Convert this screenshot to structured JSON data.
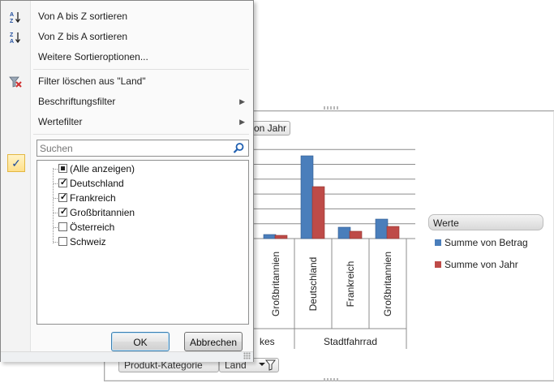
{
  "sort_menu": {
    "sort_az": "Von A bis Z sortieren",
    "sort_za": "Von Z bis A sortieren",
    "more_sort": "Weitere Sortieroptionen...",
    "clear_filter": "Filter löschen aus \"Land\"",
    "label_filter": "Beschriftungsfilter",
    "value_filter": "Wertefilter"
  },
  "search": {
    "placeholder": "Suchen"
  },
  "filter_list": [
    {
      "label": "(Alle anzeigen)",
      "state": "indeterminate"
    },
    {
      "label": "Deutschland",
      "state": "checked"
    },
    {
      "label": "Frankreich",
      "state": "checked"
    },
    {
      "label": "Großbritannien",
      "state": "checked"
    },
    {
      "label": "Österreich",
      "state": "unchecked"
    },
    {
      "label": "Schweiz",
      "state": "unchecked"
    }
  ],
  "buttons": {
    "ok": "OK",
    "cancel": "Abbrechen"
  },
  "chart_fields": {
    "column_field": "von Jahr",
    "row_field_1": "Produkt-Kategorie",
    "row_field_2": "Land"
  },
  "legend": {
    "title": "Werte",
    "items": [
      {
        "name": "Summe von Betrag",
        "color": "#4a7ebb"
      },
      {
        "name": "Summe von Jahr",
        "color": "#be4b48"
      }
    ]
  },
  "chart_data": {
    "type": "bar",
    "groups": [
      {
        "name": "…kes",
        "categories": [
          "Großbritannien"
        ]
      },
      {
        "name": "Stadtfahrrad",
        "categories": [
          "Deutschland",
          "Frankreich",
          "Großbritannien"
        ]
      }
    ],
    "categories": [
      "Großbritannien",
      "Deutschland",
      "Frankreich",
      "Großbritannien"
    ],
    "series": [
      {
        "name": "Summe von Betrag",
        "values": [
          0.5,
          10.2,
          1.4,
          2.4
        ]
      },
      {
        "name": "Summe von Jahr",
        "values": [
          0.4,
          6.4,
          0.9,
          1.5
        ]
      }
    ],
    "ylim": [
      0,
      11
    ],
    "grid": true
  },
  "colors": {
    "series1": "#4a7ebb",
    "series2": "#be4b48",
    "hover": "#ffe08a"
  }
}
